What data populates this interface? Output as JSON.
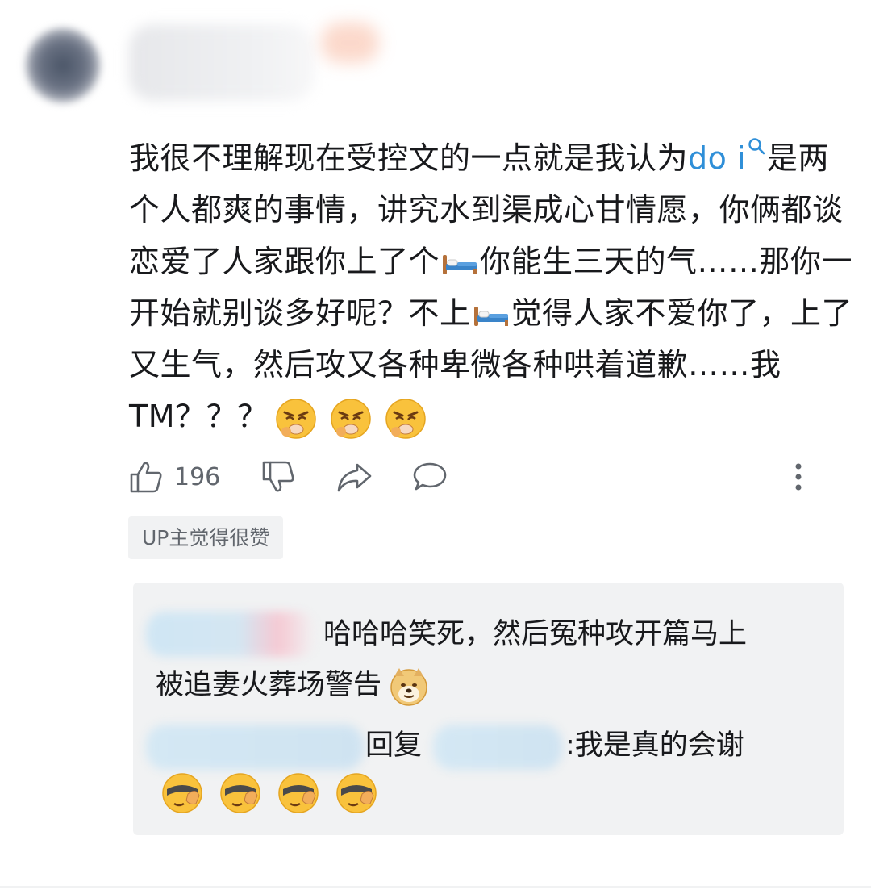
{
  "comment": {
    "text_part1": "我很不理解现在受控文的一点就是我认为",
    "search_keyword": "do i",
    "text_part2": "是两个人都爽的事情，讲究水到渠成心甘情愿，你俩都谈恋爱了人家跟你上了个",
    "text_part3": "你能生三天的气……那你一开始就别谈多好呢？不上",
    "text_part4": "觉得人家不爱你了，上了又生气，然后攻又各种卑微各种哄着道歉……我TM？？？",
    "trailing_emoji": "angry-sneeze-emoji"
  },
  "actions": {
    "like_count": "196",
    "icons": [
      "thumbs-up-icon",
      "thumbs-down-icon",
      "share-icon",
      "comment-icon",
      "more-icon"
    ]
  },
  "up_tag": "UP主觉得很赞",
  "replies": [
    {
      "text_line1": "哈哈哈笑死，然后冤种攻开篇马上",
      "text_line2": "被追妻火葬场警告",
      "emoji": "doge-emoji"
    },
    {
      "reply_word": "回复",
      "text": ":我是真的会谢",
      "emoji": "facepalm-emoji"
    }
  ],
  "colors": {
    "link": "#2f8fd8",
    "text": "#18191c",
    "secondary": "#61666d",
    "reply_bg": "#f1f2f3"
  }
}
